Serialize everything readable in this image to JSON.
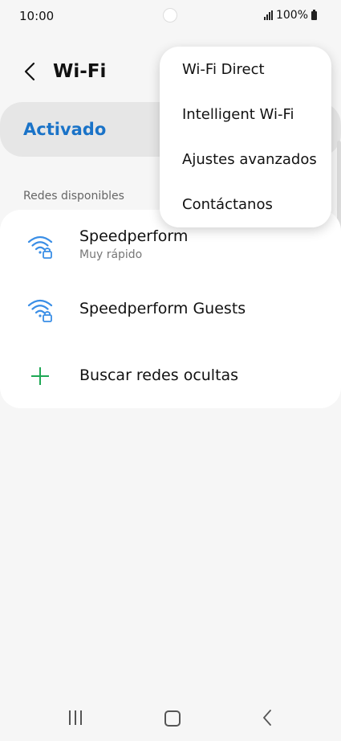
{
  "status_bar": {
    "time": "10:00",
    "battery": "100%"
  },
  "header": {
    "title": "Wi-Fi"
  },
  "toggle": {
    "label": "Activado",
    "on": true,
    "accent_color": "#1a73c8"
  },
  "networks": {
    "section_label": "Redes disponibles",
    "items": [
      {
        "name": "Speedperform",
        "subtitle": "Muy rápido",
        "icon": "wifi-lock-icon"
      },
      {
        "name": "Speedperform Guests",
        "subtitle": "",
        "icon": "wifi-lock-icon"
      }
    ],
    "add_hidden": {
      "label": "Buscar redes ocultas",
      "icon": "plus-icon",
      "icon_color": "#1fa855"
    }
  },
  "menu": {
    "items": [
      {
        "label": "Wi-Fi Direct"
      },
      {
        "label": "Intelligent Wi-Fi"
      },
      {
        "label": "Ajustes avanzados"
      },
      {
        "label": "Contáctanos"
      }
    ]
  },
  "nav": {
    "recents": "recents-icon",
    "home": "home-icon",
    "back": "back-icon"
  }
}
